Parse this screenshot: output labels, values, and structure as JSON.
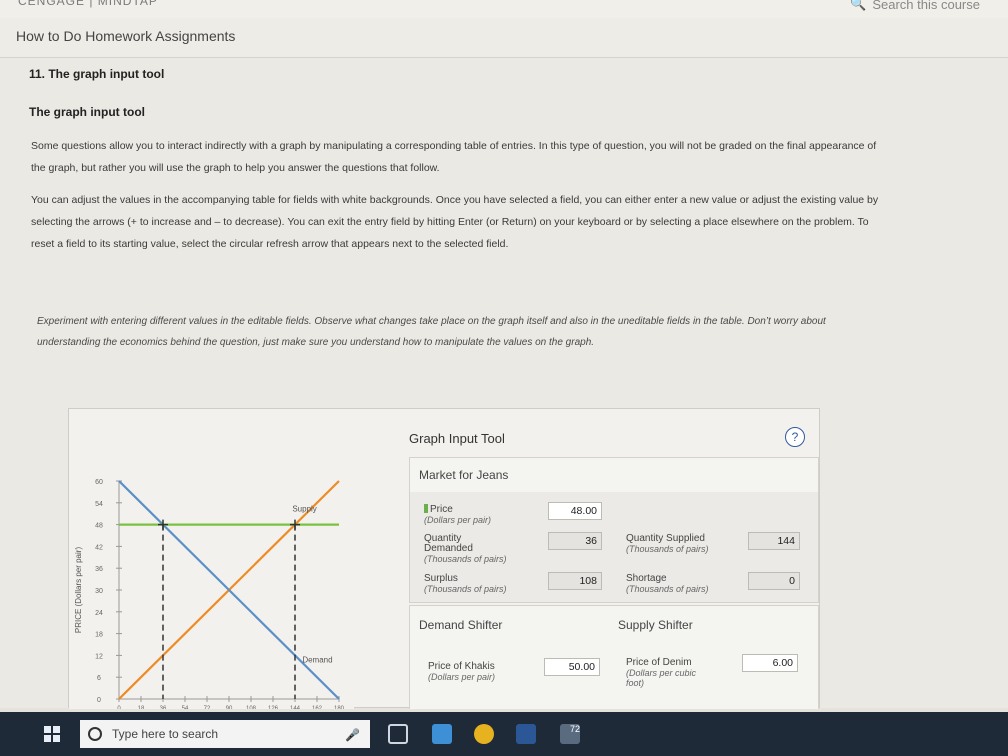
{
  "browser": {
    "brand_text": "CENGAGE | MINDTAP",
    "search_label": "Search this course"
  },
  "header": {
    "title": "How to Do Homework Assignments"
  },
  "section": {
    "number_title": "11. The graph input tool",
    "title": "The graph input tool",
    "para1": "Some questions allow you to interact indirectly with a graph by manipulating a corresponding table of entries. In this type of question, you will not be graded on the final appearance of the graph, but rather you will use the graph to help you answer the questions that follow.",
    "para2": "You can adjust the values in the accompanying table for fields with white backgrounds. Once you have selected a field, you can either enter a new value or adjust the existing value by selecting the arrows (+ to increase and – to decrease). You can exit the entry field by hitting Enter (or Return) on your keyboard or by selecting a place elsewhere on the problem. To reset a field to its starting value, select the circular refresh arrow that appears next to the selected field.",
    "para3": "Experiment with entering different values in the editable fields. Observe what changes take place on the graph itself and also in the uneditable fields in the table. Don’t worry about understanding the economics behind the question, just make sure you understand how to manipulate the values on the graph."
  },
  "tool": {
    "title": "Graph Input Tool",
    "help_label": "?",
    "market_title": "Market for Jeans",
    "price_label": "Price",
    "price_unit": "(Dollars per pair)",
    "price_value": "48.00",
    "qd_label_1": "Quantity",
    "qd_label_2": "Demanded",
    "qd_unit": "(Thousands of pairs)",
    "qd_value": "36",
    "qs_label": "Quantity Supplied",
    "qs_unit": "(Thousands of pairs)",
    "qs_value": "144",
    "surplus_label": "Surplus",
    "surplus_unit": "(Thousands of pairs)",
    "surplus_value": "108",
    "shortage_label": "Shortage",
    "shortage_unit": "(Thousands of pairs)",
    "shortage_value": "0",
    "demand_shifter_title": "Demand Shifter",
    "supply_shifter_title": "Supply Shifter",
    "khakis_label": "Price of Khakis",
    "khakis_unit": "(Dollars per pair)",
    "khakis_value": "50.00",
    "denim_label": "Price of Denim",
    "denim_unit_1": "(Dollars per cubic",
    "denim_unit_2": "foot)",
    "denim_value": "6.00"
  },
  "chart_data": {
    "type": "line",
    "ylabel": "PRICE (Dollars per pair)",
    "xlabel": "",
    "yticks": [
      0,
      6,
      12,
      18,
      24,
      30,
      36,
      42,
      48,
      54,
      60
    ],
    "xticks": [
      0,
      18,
      36,
      54,
      72,
      90,
      108,
      126,
      144,
      162,
      180
    ],
    "xlim": [
      0,
      180
    ],
    "ylim": [
      0,
      60
    ],
    "series": [
      {
        "name": "Supply",
        "color": "#f08a24",
        "x": [
          0,
          180
        ],
        "y": [
          0,
          60
        ]
      },
      {
        "name": "Demand",
        "color": "#5b8fc7",
        "x": [
          0,
          180
        ],
        "y": [
          60,
          0
        ]
      },
      {
        "name": "",
        "color": "#7ac142",
        "x": [
          0,
          180
        ],
        "y": [
          48,
          48
        ]
      }
    ],
    "markers": [
      {
        "x": 36,
        "y": 48
      },
      {
        "x": 144,
        "y": 48
      }
    ]
  },
  "taskbar": {
    "search_placeholder": "Type here to search",
    "badge": "72"
  }
}
